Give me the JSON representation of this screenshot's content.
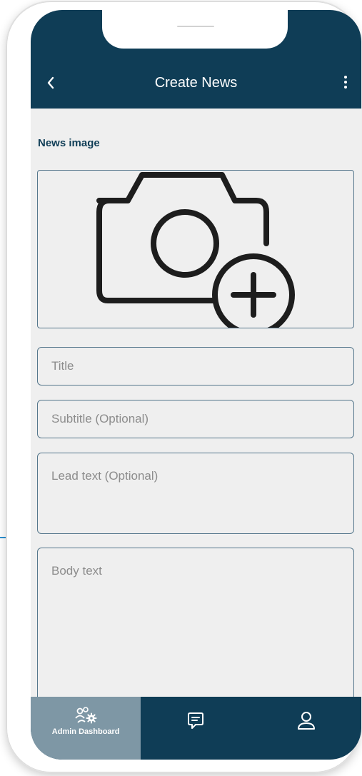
{
  "header": {
    "title": "Create News",
    "back_icon": "chevron-left-icon",
    "menu_icon": "more-vertical-icon",
    "background": "#0f3d56"
  },
  "form": {
    "image_section_label": "News image",
    "image_picker_icon": "add-photo-icon",
    "fields": {
      "title_placeholder": "Title",
      "subtitle_placeholder": "Subtitle (Optional)",
      "lead_placeholder": "Lead text (Optional)",
      "body_placeholder": "Body text"
    }
  },
  "bottom_nav": {
    "items": [
      {
        "label": "Admin Dashboard",
        "icon": "admin-dashboard-icon",
        "active": true
      },
      {
        "label": "",
        "icon": "chat-icon",
        "active": false
      },
      {
        "label": "",
        "icon": "profile-icon",
        "active": false
      }
    ],
    "active_color": "#7e97a5"
  }
}
